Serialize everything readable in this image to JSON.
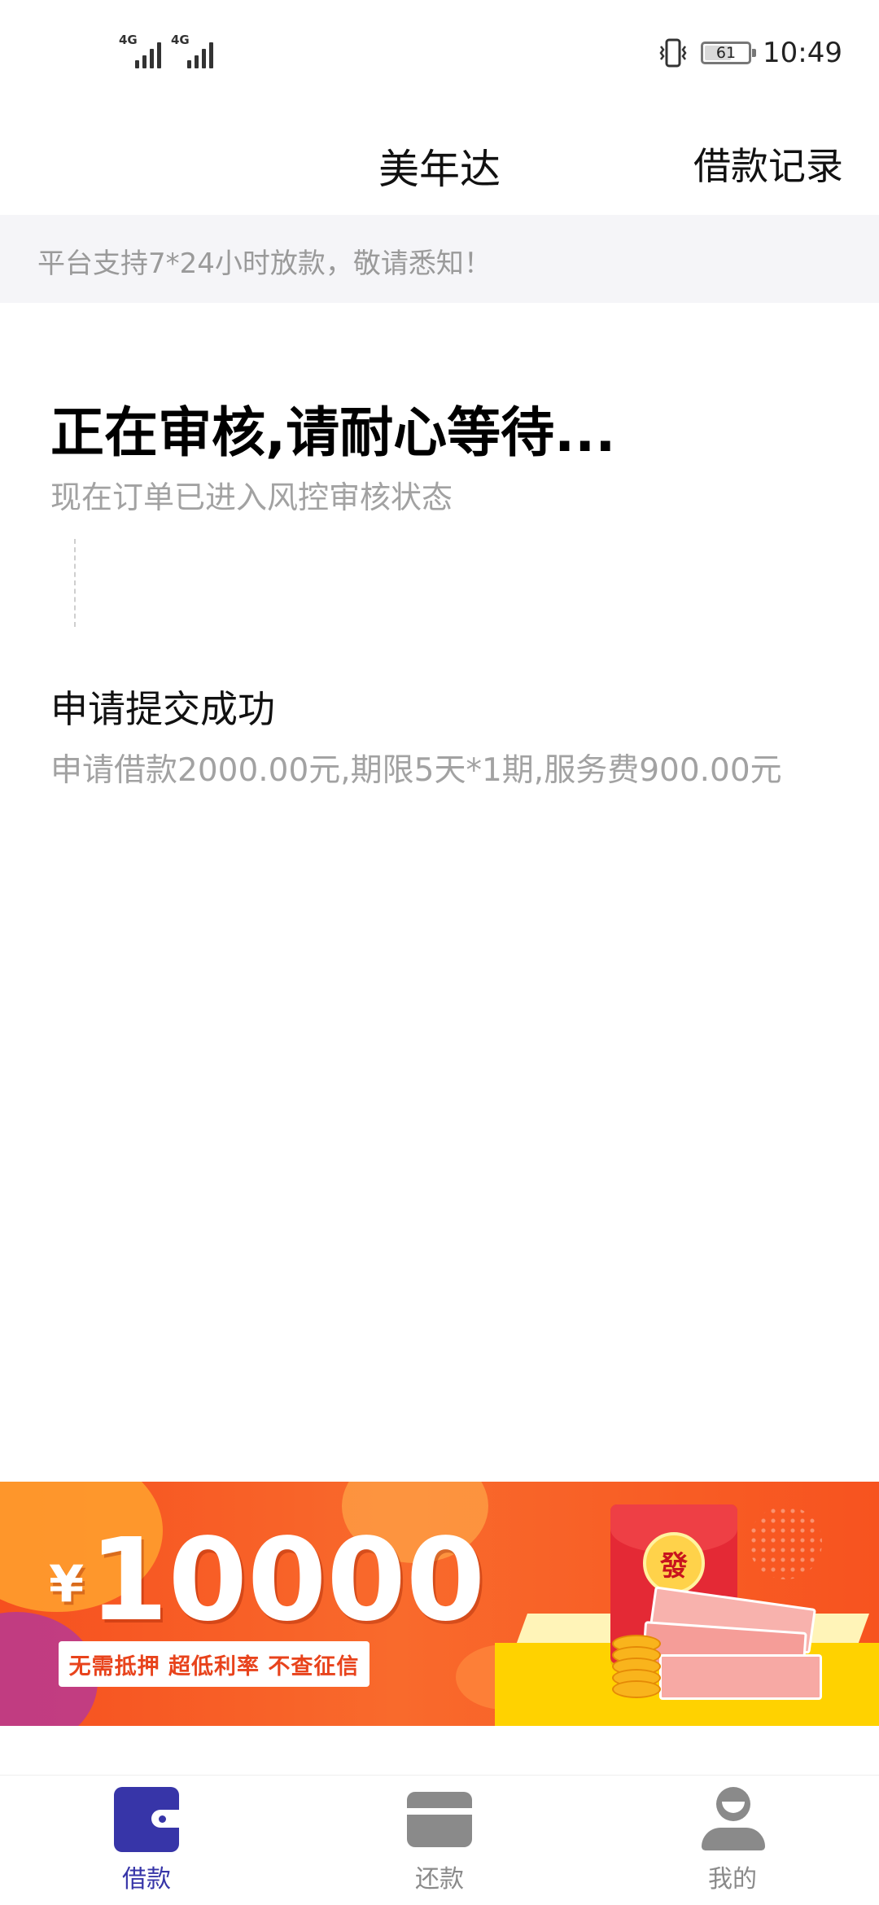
{
  "status_bar": {
    "network_1": "4G",
    "network_2": "4G",
    "battery_level": "61",
    "time": "10:49"
  },
  "header": {
    "title": "美年达",
    "records_link": "借款记录"
  },
  "notice": {
    "text": "平台支持7*24小时放款，敬请悉知！"
  },
  "review": {
    "title": "正在审核,请耐心等待...",
    "description": "现在订单已进入风控审核状态"
  },
  "step": {
    "title": "申请提交成功",
    "description": "申请借款2000.00元,期限5天*1期,服务费900.00元"
  },
  "banner": {
    "currency": "¥",
    "amount": "10000",
    "tagline": "无需抵押 超低利率 不查征信",
    "envelope_char": "發",
    "colors": {
      "background": "#f6501f",
      "accent": "#ffd200"
    }
  },
  "tabbar": {
    "tabs": [
      {
        "label": "借款",
        "icon": "wallet-icon",
        "active": true,
        "color": "#3735a8"
      },
      {
        "label": "还款",
        "icon": "card-icon",
        "active": false,
        "color": "#8a8a8a"
      },
      {
        "label": "我的",
        "icon": "user-icon",
        "active": false,
        "color": "#8a8a8a"
      }
    ]
  }
}
